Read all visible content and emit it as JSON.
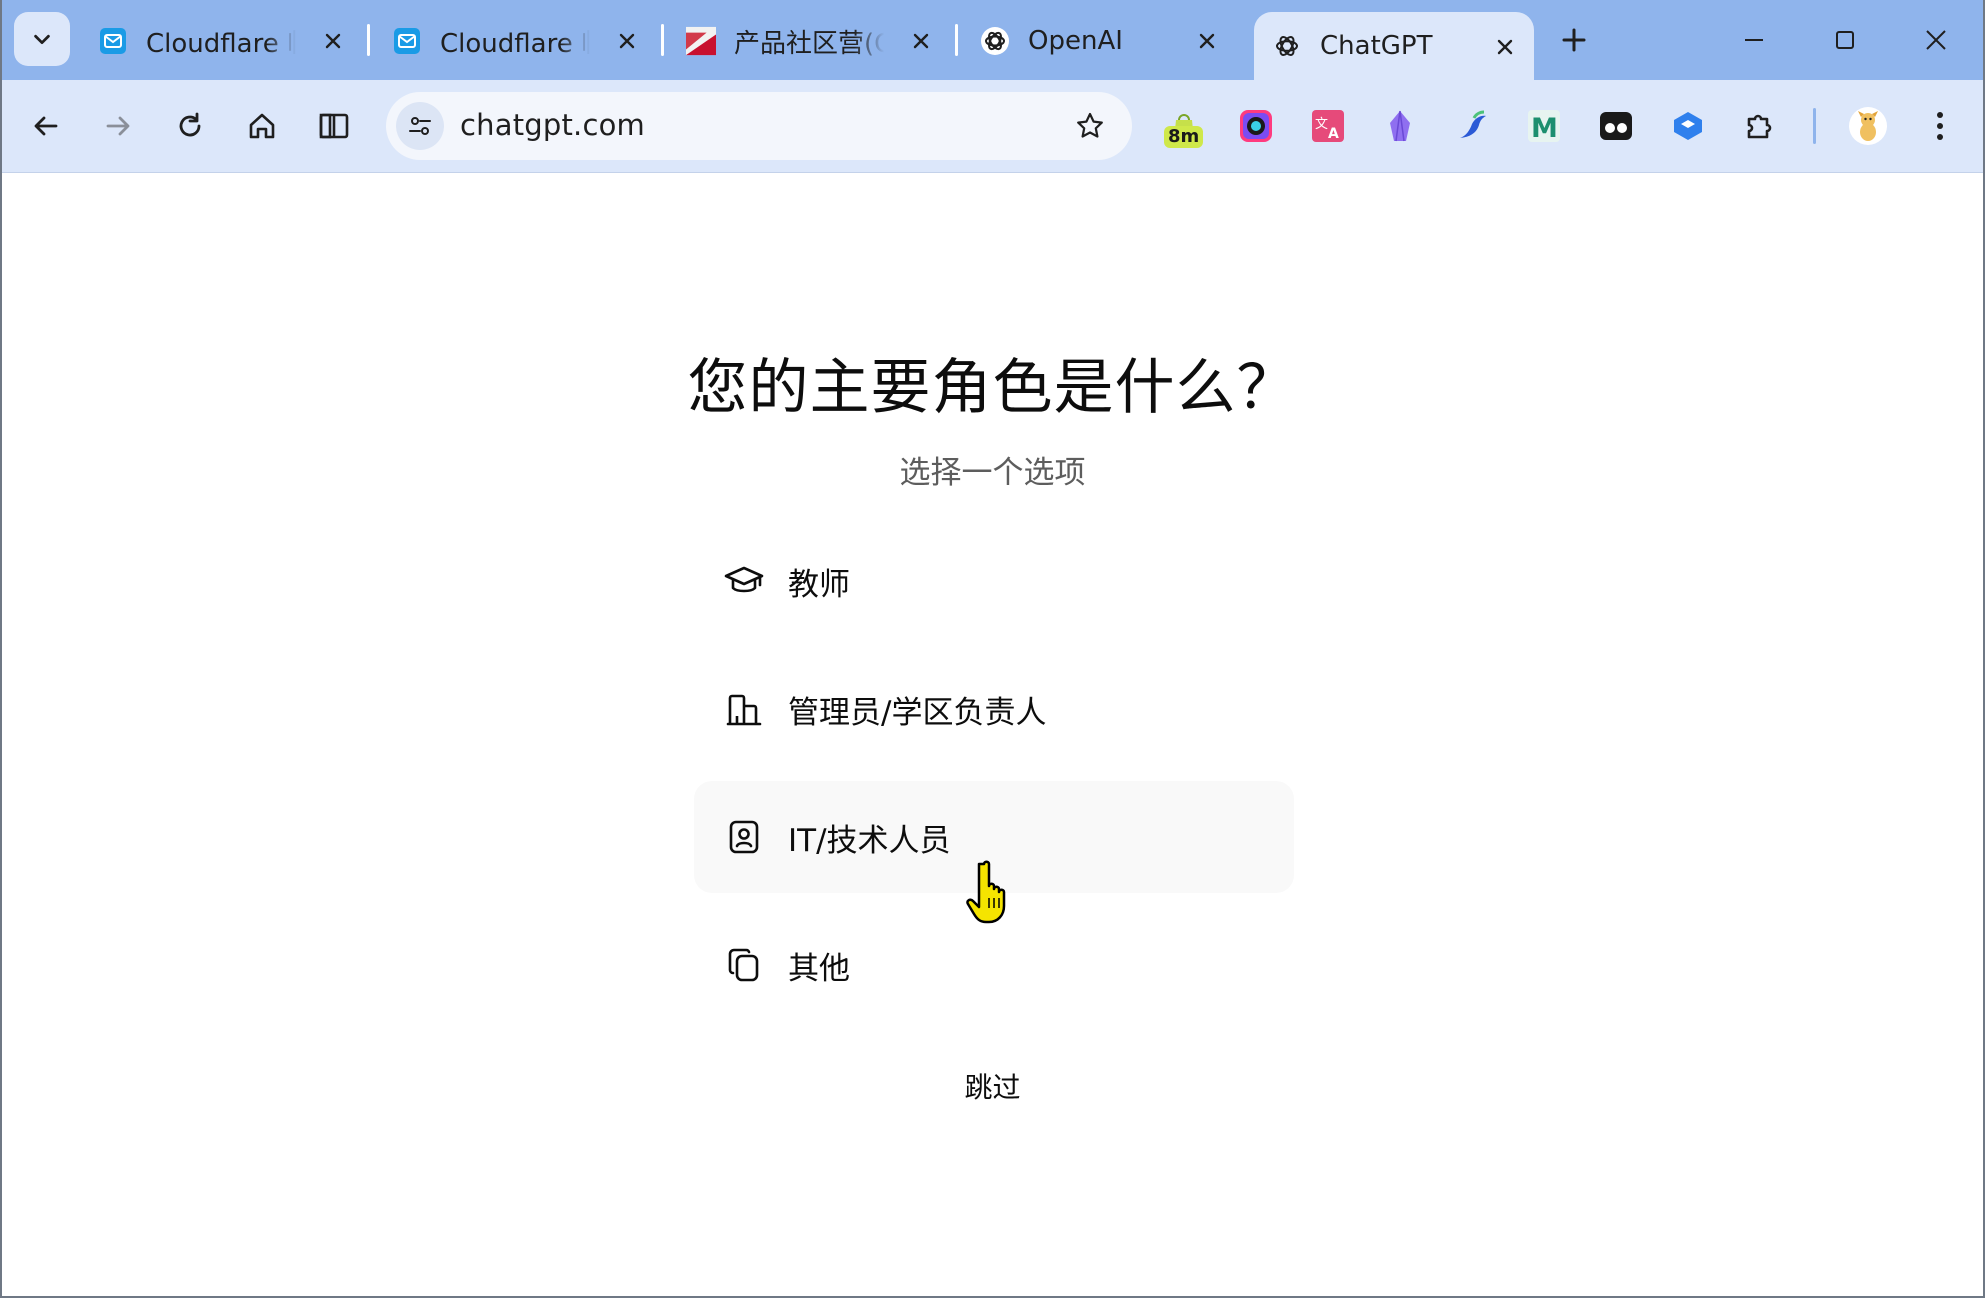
{
  "browser": {
    "tabs": [
      {
        "title": "Cloudflare 临时邮箱",
        "favicon": "mail-icon",
        "active": false
      },
      {
        "title": "Cloudflare 临时邮箱",
        "favicon": "mail-icon",
        "active": false
      },
      {
        "title": "产品社区营(Cl",
        "favicon": "flag-icon",
        "active": false
      },
      {
        "title": "OpenAI",
        "favicon": "openai-icon",
        "active": false
      },
      {
        "title": "ChatGPT",
        "favicon": "openai-icon",
        "active": true
      }
    ],
    "url": "chatgpt.com",
    "extension_badge": "8m",
    "colors": {
      "tabstrip": "#8fb4ec",
      "toolbar": "#dce7fa",
      "omnibox": "#f3f6fc"
    }
  },
  "page": {
    "title": "您的主要角色是什么？",
    "subtitle": "选择一个选项",
    "options": [
      {
        "label": "教师",
        "icon": "graduation-cap-icon"
      },
      {
        "label": "管理员/学区负责人",
        "icon": "building-icon"
      },
      {
        "label": "IT/技术人员",
        "icon": "id-badge-icon",
        "hovered": true
      },
      {
        "label": "其他",
        "icon": "copy-icon"
      }
    ],
    "skip_label": "跳过"
  }
}
